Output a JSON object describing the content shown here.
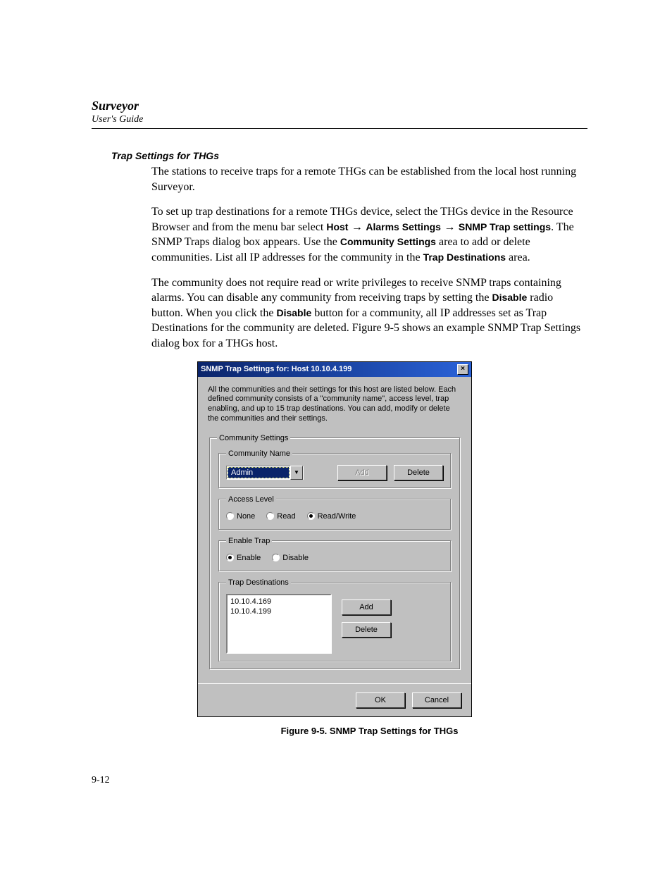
{
  "header": {
    "title": "Surveyor",
    "subtitle": "User's Guide"
  },
  "section_heading": "Trap Settings for THGs",
  "paragraphs": {
    "p1": "The stations to receive traps for a remote THGs can be established from the local host running Surveyor.",
    "p2a": "To set up trap destinations for a remote THGs device, select the THGs device in the Resource Browser and from the menu bar select ",
    "p2_menu_host": "Host",
    "p2_arrow": " → ",
    "p2_menu_alarms": "Alarms Settings",
    "p2_menu_snmp": "SNMP Trap settings",
    "p2b": ". The SNMP Traps dialog box appears. Use the ",
    "p2_cs": "Community Settings",
    "p2c": " area to add or delete communities. List all IP addresses for the community in the ",
    "p2_td": "Trap Destinations",
    "p2d": " area.",
    "p3a": "The community does not require read or write privileges to receive SNMP traps containing alarms. You can disable any community from receiving traps by setting the ",
    "p3_disable1": "Disable",
    "p3b": " radio button. When you click the ",
    "p3_disable2": "Disable",
    "p3c": " button for a community, all IP addresses set as Trap Destinations for the community are deleted. Figure 9-5 shows an example SNMP Trap Settings dialog box for a THGs host."
  },
  "dialog": {
    "title": "SNMP Trap Settings for: Host 10.10.4.199",
    "description": "All the communities and their settings for this host are listed below.  Each defined community consists of a \"community name\", access level, trap enabling, and up to 15 trap destinations.  You can add, modify or delete the communities and their settings.",
    "community_settings_legend": "Community Settings",
    "community_name_legend": "Community Name",
    "community_selected": "Admin",
    "btn_add": "Add",
    "btn_delete": "Delete",
    "access_level_legend": "Access Level",
    "access_none": "None",
    "access_read": "Read",
    "access_rw": "Read/Write",
    "access_selected": "Read/Write",
    "enable_trap_legend": "Enable Trap",
    "trap_enable": "Enable",
    "trap_disable": "Disable",
    "trap_selected": "Enable",
    "trap_dest_legend": "Trap Destinations",
    "trap_destinations": [
      "10.10.4.169",
      "10.10.4.199"
    ],
    "btn_dest_add": "Add",
    "btn_dest_delete": "Delete",
    "btn_ok": "OK",
    "btn_cancel": "Cancel"
  },
  "figure_caption": "Figure 9-5.  SNMP Trap Settings for THGs",
  "page_number": "9-12"
}
